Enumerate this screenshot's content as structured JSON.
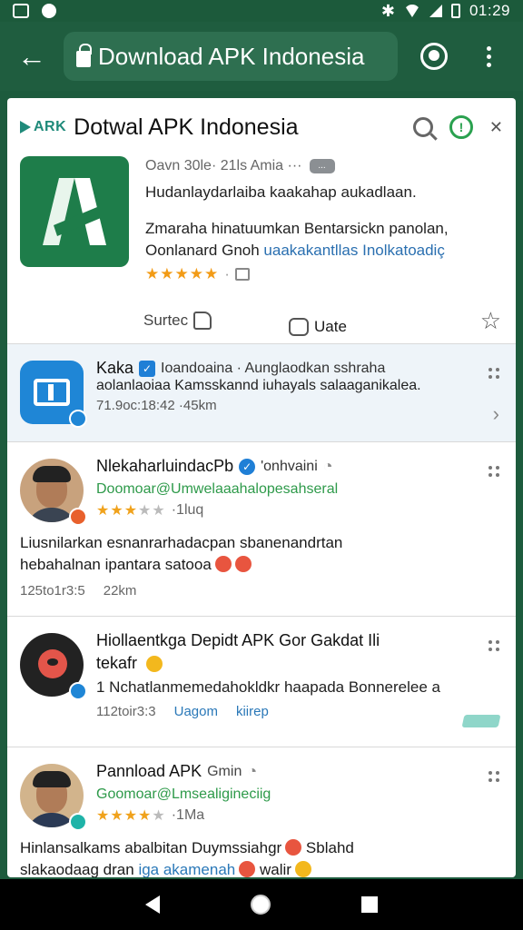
{
  "status": {
    "time": "01:29"
  },
  "topbar": {
    "url_title": "Download APK Indonesia"
  },
  "header": {
    "brand": "ARK",
    "title": "Dotwal APK Indonesia"
  },
  "app": {
    "meta": "Oavn 30le· 21ls Amia ···",
    "meta_pill": "...",
    "desc1": "Hudanlaydarlaiba kaakahap aukadlaan.",
    "desc2a": "Zmaraha hinatuumkan Bentarsickn panolan,",
    "desc2b_plain": "Oonlanard Gnoh ",
    "desc2b_link": "uaakakantllas Inolkatoadiç",
    "stars": "★★★★★",
    "like_label": "Surtec",
    "comment_label": "Uate"
  },
  "sponsored": {
    "title": "Kaka",
    "title_rest": "Ioandoaina · Aunglaodkan sshraha",
    "body": "aolanlaoiaa Kamsskannd iuhayals salaaganikalea.",
    "foot": "71.9oc:18:42 ·45km"
  },
  "posts": [
    {
      "name": "NlekaharluindacPb",
      "name_rest": "'onhvaini",
      "handle": "Doomoar@Umwelaaahalopesahseral",
      "stars_filled": "★★★",
      "stars_empty": "★★",
      "rating_note": "·1luq",
      "comment1": "Liusnilarkan esnanrarhadacpan sbanenandrtan",
      "comment2": "hebahalnan ipantara satooa",
      "foot_time": "125to1r3:5",
      "foot_dist": "22km"
    },
    {
      "name": "Hiollaentkga Depidt APK Gor Gakdat Ili",
      "name2": "tekafr",
      "comment1": "1 Nchatlanmemedahokldkr haapada Bonnerelee a",
      "foot_time": "112toir3:3",
      "foot_link1": "Uagom",
      "foot_link2": "kiirep"
    },
    {
      "name": "Pannload APK",
      "name_rest": "Gmin",
      "handle": "Goomoar@Lmsealigineciig",
      "stars_filled": "★★★★",
      "stars_empty": "★",
      "rating_note": "·1Ma",
      "comment1": "Hinlansalkams abalbitan Duymssiahgr",
      "comment1b": "Sblahd",
      "comment2a": "slakaodaag dran ",
      "comment2b_link": "iga akamenah",
      "comment2c": " walir"
    }
  ]
}
